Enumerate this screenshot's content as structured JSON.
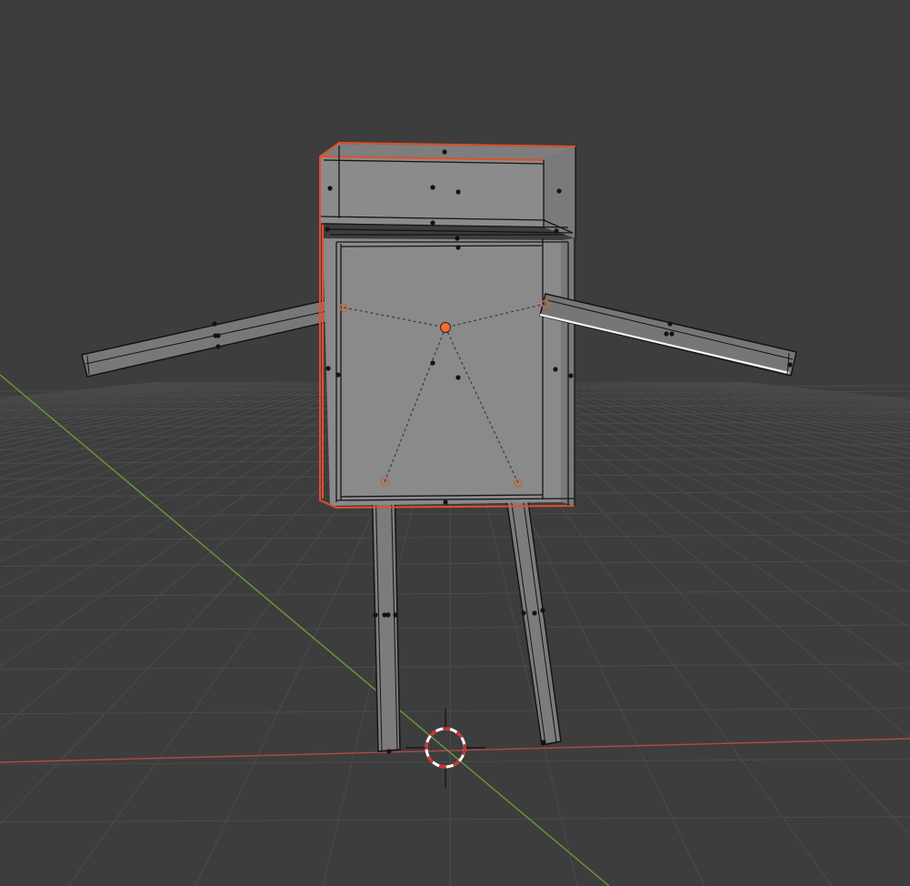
{
  "app": {
    "name": "3D Viewport"
  },
  "scene": {
    "background_color": "#3d3d3d",
    "grid_color": "#4c4c4c",
    "axis_x_color": "#c05050",
    "axis_y_color": "#6e9a3a",
    "selection_active_color": "#e04a20",
    "selection_color": "#f0f0f0",
    "object_origin_color": "#f07030",
    "mesh_face_color": "#858585",
    "edge_color": "#141414"
  },
  "objects": [
    {
      "id": "torso",
      "selected": true,
      "active": true
    },
    {
      "id": "head",
      "selected": true
    },
    {
      "id": "left_arm",
      "selected": false
    },
    {
      "id": "right_arm",
      "selected": true
    },
    {
      "id": "left_leg",
      "selected": false
    },
    {
      "id": "right_leg",
      "selected": false
    }
  ],
  "cursor_3d": {
    "icon": "3d-cursor-icon"
  },
  "active_origin": {
    "icon": "object-origin-icon"
  }
}
